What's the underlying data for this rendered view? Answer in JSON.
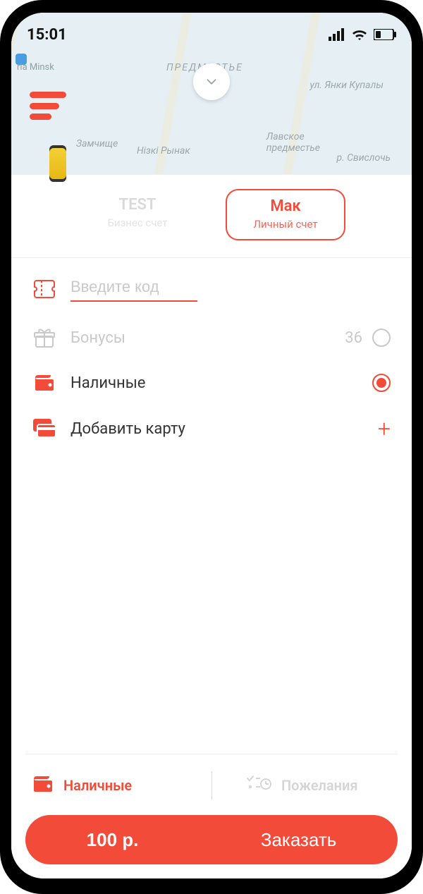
{
  "status": {
    "time": "15:01"
  },
  "map": {
    "poi_label": "ria Minsk",
    "streets": {
      "top_center": "ПРЕДМЕСТЬЕ",
      "top_right": "ул. Янки Купалы",
      "mid_left": "Замчище",
      "mid_center": "Нізкі Рынак",
      "mid_right_line1": "Лавское",
      "mid_right_line2": "предместье",
      "river": "р. Свислочь"
    }
  },
  "tabs": [
    {
      "title": "TEST",
      "subtitle": "Бизнес счет"
    },
    {
      "title": "Мак",
      "subtitle": "Личный счет"
    }
  ],
  "rows": {
    "code": {
      "placeholder": "Введите код"
    },
    "bonuses": {
      "label": "Бонусы",
      "value": "36"
    },
    "cash": {
      "label": "Наличные"
    },
    "add_card": {
      "label": "Добавить карту"
    }
  },
  "dock": {
    "left_label": "Наличные",
    "right_label": "Пожелания"
  },
  "order": {
    "price": "100 р.",
    "action": "Заказать"
  }
}
